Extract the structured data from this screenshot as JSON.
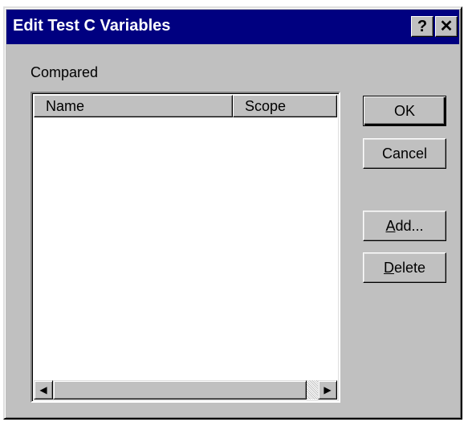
{
  "dialog": {
    "title": "Edit Test C Variables",
    "help_glyph": "?",
    "close_glyph": "✕"
  },
  "compared_label": "Compared",
  "list": {
    "columns": [
      "Name",
      "Scope"
    ],
    "rows": []
  },
  "scrollbar": {
    "left_arrow": "◀",
    "right_arrow": "▶"
  },
  "buttons": {
    "ok": "OK",
    "cancel": "Cancel",
    "add_accel": "A",
    "add_rest": "dd...",
    "delete_accel": "D",
    "delete_rest": "elete"
  },
  "colors": {
    "face": "#c0c0c0",
    "titlebar": "#000080",
    "list_background": "#ffffff"
  }
}
